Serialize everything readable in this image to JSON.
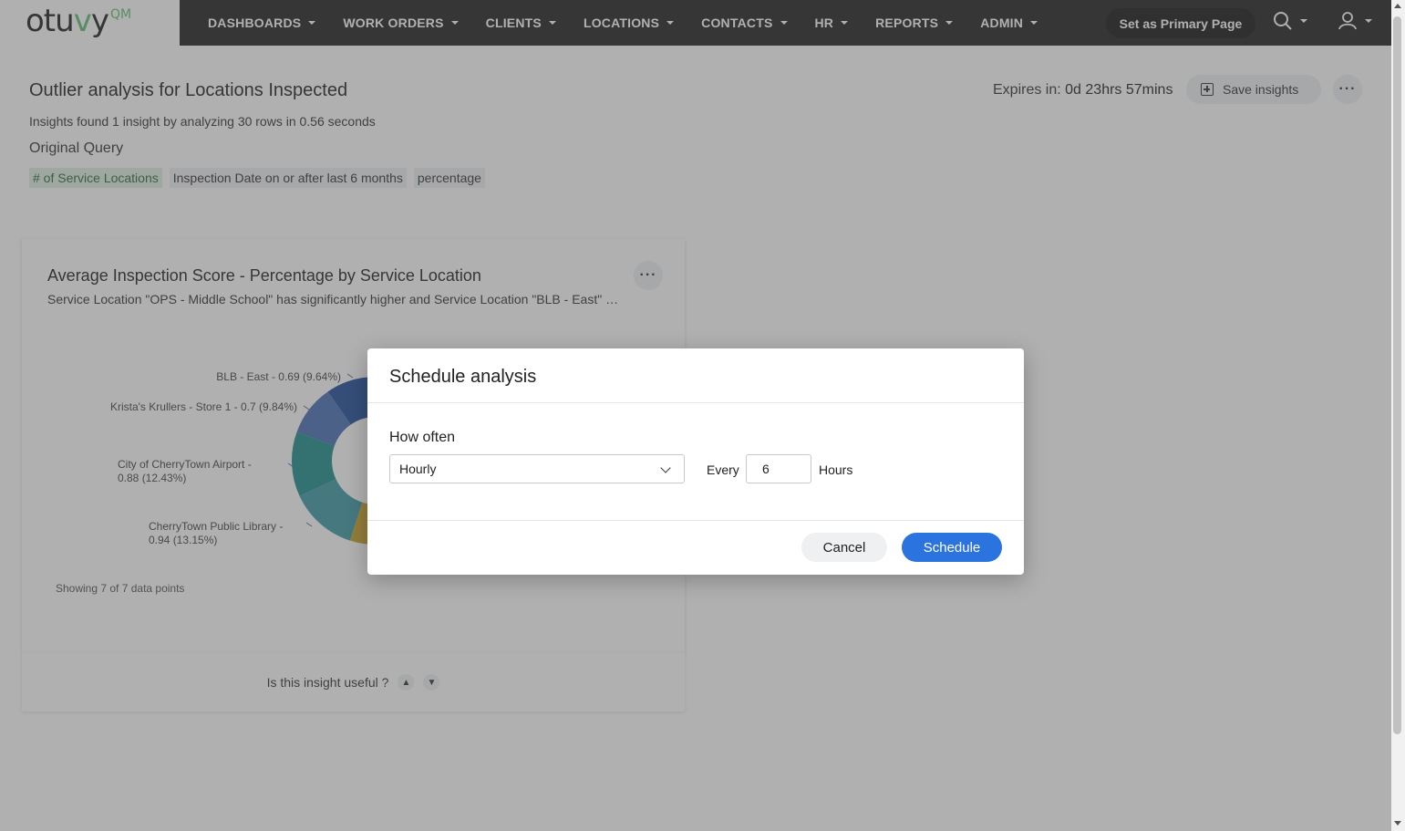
{
  "logo": {
    "text_pre": "otu",
    "text_v": "v",
    "text_post": "y",
    "superscript": "QM"
  },
  "nav": {
    "items": [
      {
        "label": "DASHBOARDS"
      },
      {
        "label": "WORK ORDERS"
      },
      {
        "label": "CLIENTS"
      },
      {
        "label": "LOCATIONS"
      },
      {
        "label": "CONTACTS"
      },
      {
        "label": "HR"
      },
      {
        "label": "REPORTS"
      },
      {
        "label": "ADMIN"
      }
    ],
    "primary_page_label": "Set as Primary Page",
    "icons": {
      "search": "search-icon",
      "user": "user-icon"
    }
  },
  "header": {
    "title": "Outlier analysis for Locations Inspected",
    "summary": "Insights found 1 insight by analyzing 30 rows in 0.56 seconds",
    "original_query_label": "Original Query",
    "chips": [
      "# of Service Locations",
      "Inspection Date on or after last 6 months",
      "percentage"
    ],
    "expires_label": "Expires in:",
    "expires_value": "0d 23hrs 57mins",
    "save_label": "Save insights",
    "more_label": "···"
  },
  "card": {
    "title": "Average Inspection Score - Percentage by Service Location",
    "description": "Service Location \"OPS - Middle School\" has significantly higher and Service Location \"BLB - East\" has significantly lower Average Inspection Score - Percentage",
    "more_label": "···",
    "showing": "Showing 7 of 7 data points",
    "feedback_question": "Is this insight useful ?"
  },
  "chart_data": {
    "type": "pie",
    "visible_labels": [
      {
        "line1": "BLB - East - 0.69 (9.64%)",
        "line2": ""
      },
      {
        "line1": "Krista's Krullers - Store 1 - 0.7 (9.84%)",
        "line2": ""
      },
      {
        "line1": "City of CherryTown Airport -",
        "line2": "0.88 (12.43%)"
      },
      {
        "line1": "CherryTown Public Library -",
        "line2": "0.94 (13.15%)"
      }
    ],
    "slices": [
      {
        "label": "BLB - East",
        "value": 0.69,
        "percent": 9.64,
        "color": "#1f4e9c"
      },
      {
        "label": "Krista's Krullers - Store 1",
        "value": 0.7,
        "percent": 9.84,
        "color": "#4a6fb5"
      },
      {
        "label": "City of CherryTown Airport",
        "value": 0.88,
        "percent": 12.43,
        "color": "#1e8c8c"
      },
      {
        "label": "CherryTown Public Library",
        "value": 0.94,
        "percent": 13.15,
        "color": "#3f9aa8"
      },
      {
        "label": "",
        "percent": 12.0,
        "color": "#c9a227"
      },
      {
        "label": "",
        "percent": 30.0,
        "color": "#d4d4d4"
      },
      {
        "label": "",
        "percent": 12.94,
        "color": "#1a8a5a"
      }
    ]
  },
  "dialog": {
    "title": "Schedule analysis",
    "how_often_label": "How often",
    "frequency_value": "Hourly",
    "every_label": "Every",
    "interval_value": "6",
    "unit_label": "Hours",
    "cancel_label": "Cancel",
    "schedule_label": "Schedule"
  }
}
